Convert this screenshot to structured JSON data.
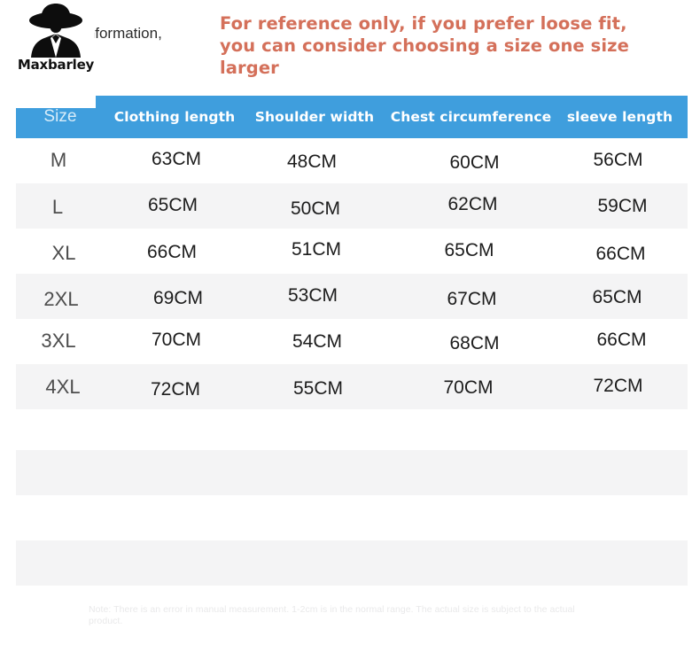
{
  "header": {
    "brand_name": "Maxbarley",
    "logo_icon": "person-in-hat-logo-icon",
    "info_text": "information,",
    "notice_line_1": "For reference only, if you prefer loose fit,",
    "notice_line_2": "you can consider choosing a size one size larger",
    "notice_color": "#d4705a"
  },
  "table": {
    "header_bg_color": "#3f9edd",
    "alt_row_color": "#f4f4f5",
    "columns": [
      "Size",
      "Clothing length",
      "Shoulder width",
      "Chest circumference",
      "sleeve length"
    ],
    "rows": [
      {
        "size": "M",
        "clothing_length": "63CM",
        "shoulder_width": "48CM",
        "chest_circumference": "60CM",
        "sleeve_length": "56CM"
      },
      {
        "size": "L",
        "clothing_length": "65CM",
        "shoulder_width": "50CM",
        "chest_circumference": "62CM",
        "sleeve_length": "59CM"
      },
      {
        "size": "XL",
        "clothing_length": "66CM",
        "shoulder_width": "51CM",
        "chest_circumference": "65CM",
        "sleeve_length": "66CM"
      },
      {
        "size": "2XL",
        "clothing_length": "69CM",
        "shoulder_width": "53CM",
        "chest_circumference": "67CM",
        "sleeve_length": "65CM"
      },
      {
        "size": "3XL",
        "clothing_length": "70CM",
        "shoulder_width": "54CM",
        "chest_circumference": "68CM",
        "sleeve_length": "66CM"
      },
      {
        "size": "4XL",
        "clothing_length": "72CM",
        "shoulder_width": "55CM",
        "chest_circumference": "70CM",
        "sleeve_length": "72CM"
      }
    ]
  },
  "footnote": {
    "text": "Note: There is an error in manual measurement. 1-2cm is in the normal range. The actual size is subject to the actual product."
  }
}
